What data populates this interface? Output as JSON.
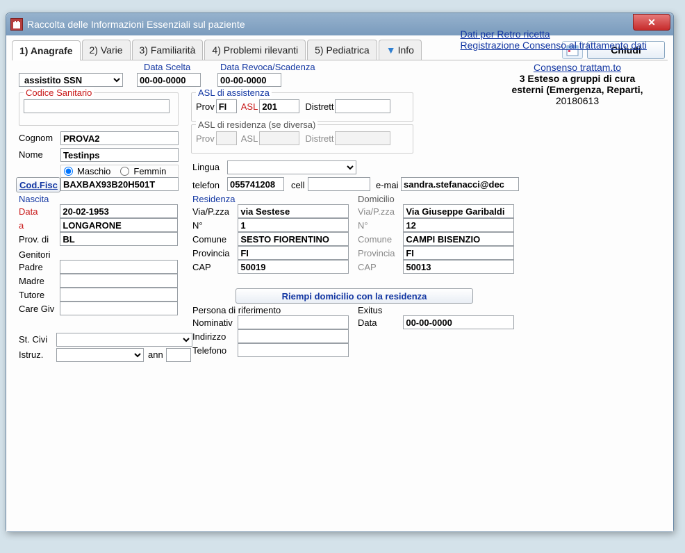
{
  "window": {
    "title": "Raccolta delle Informazioni Essenziali sul paziente"
  },
  "tabs": [
    "1) Anagrafe",
    "2) Varie",
    "3) Familiarità",
    "4) Problemi rilevanti",
    "5) Pediatrica",
    "Info"
  ],
  "chiudi": "Chiudi",
  "assistito_sel": "assistito SSN",
  "data_scelta": {
    "label": "Data Scelta",
    "value": "00-00-0000"
  },
  "data_revoca": {
    "label": "Data Revoca/Scadenza",
    "value": "00-00-0000"
  },
  "cod_san": {
    "label": "Codice Sanitario",
    "value": ""
  },
  "asl_ass": {
    "label": "ASL di assistenza",
    "prov": "FI",
    "asl": "201",
    "distr": ""
  },
  "asl_res": {
    "label": "ASL di residenza (se diversa)",
    "prov": "",
    "asl": "",
    "distr": ""
  },
  "labels": {
    "prov": "Prov",
    "asl": "ASL",
    "distretto": "Distrett"
  },
  "cognome": {
    "label": "Cognom",
    "value": "PROVA2"
  },
  "nome": {
    "label": "Nome",
    "value": "Testinps"
  },
  "sex_m": "Maschio",
  "sex_f": "Femmin",
  "codfisc": {
    "btn": "Cod.Fisc",
    "value": "BAXBAX93B20H501T"
  },
  "lingua": {
    "label": "Lingua",
    "value": ""
  },
  "telefono": {
    "label": "telefon",
    "value": "055741208"
  },
  "cell": {
    "label": "cell",
    "value": ""
  },
  "email": {
    "label": "e-mai",
    "value": "sandra.stefanacci@dec"
  },
  "nascita": {
    "label": "Nascita",
    "data_label": "Data",
    "data": "20-02-1953",
    "a_label": "a",
    "a": "LONGARONE",
    "prov_label": "Prov. di",
    "prov": "BL"
  },
  "genitori": {
    "label": "Genitori",
    "padre": "Padre",
    "madre": "Madre",
    "tutore": "Tutore",
    "caregiver": "Care Giv"
  },
  "stcivile": {
    "label": "St. Civi"
  },
  "istruz": {
    "label": "Istruz.",
    "anni": "ann"
  },
  "residenza": {
    "label": "Residenza",
    "via_label": "Via/P.zza",
    "via": "via Sestese",
    "n_label": "N°",
    "n": "1",
    "comune_label": "Comune",
    "comune": "SESTO FIORENTINO",
    "prov_label": "Provincia",
    "prov": "FI",
    "cap_label": "CAP",
    "cap": "50019"
  },
  "domicilio": {
    "label": "Domicilio",
    "via_label": "Via/P.zza",
    "via": "Via Giuseppe Garibaldi",
    "n_label": "N°",
    "n": "12",
    "comune_label": "Comune",
    "comune": "CAMPI BISENZIO",
    "prov_label": "Provincia",
    "prov": "FI",
    "cap_label": "CAP",
    "cap": "50013"
  },
  "riempi": "Riempi domicilio con la residenza",
  "riferimento": {
    "label": "Persona di riferimento",
    "nom": "Nominativ",
    "ind": "Indirizzo",
    "tel": "Telefono"
  },
  "exitus": {
    "label": "Exitus",
    "data_label": "Data",
    "data": "00-00-0000"
  },
  "consenso": {
    "hdr": "Consenso trattam.to",
    "body": "3 Esteso a gruppi di cura esterni (Emergenza, Reparti,",
    "date": "20180613"
  },
  "footer": {
    "retro": "Dati per Retro ricetta",
    "reg": "Registrazione Consenso al trattamento dati"
  }
}
